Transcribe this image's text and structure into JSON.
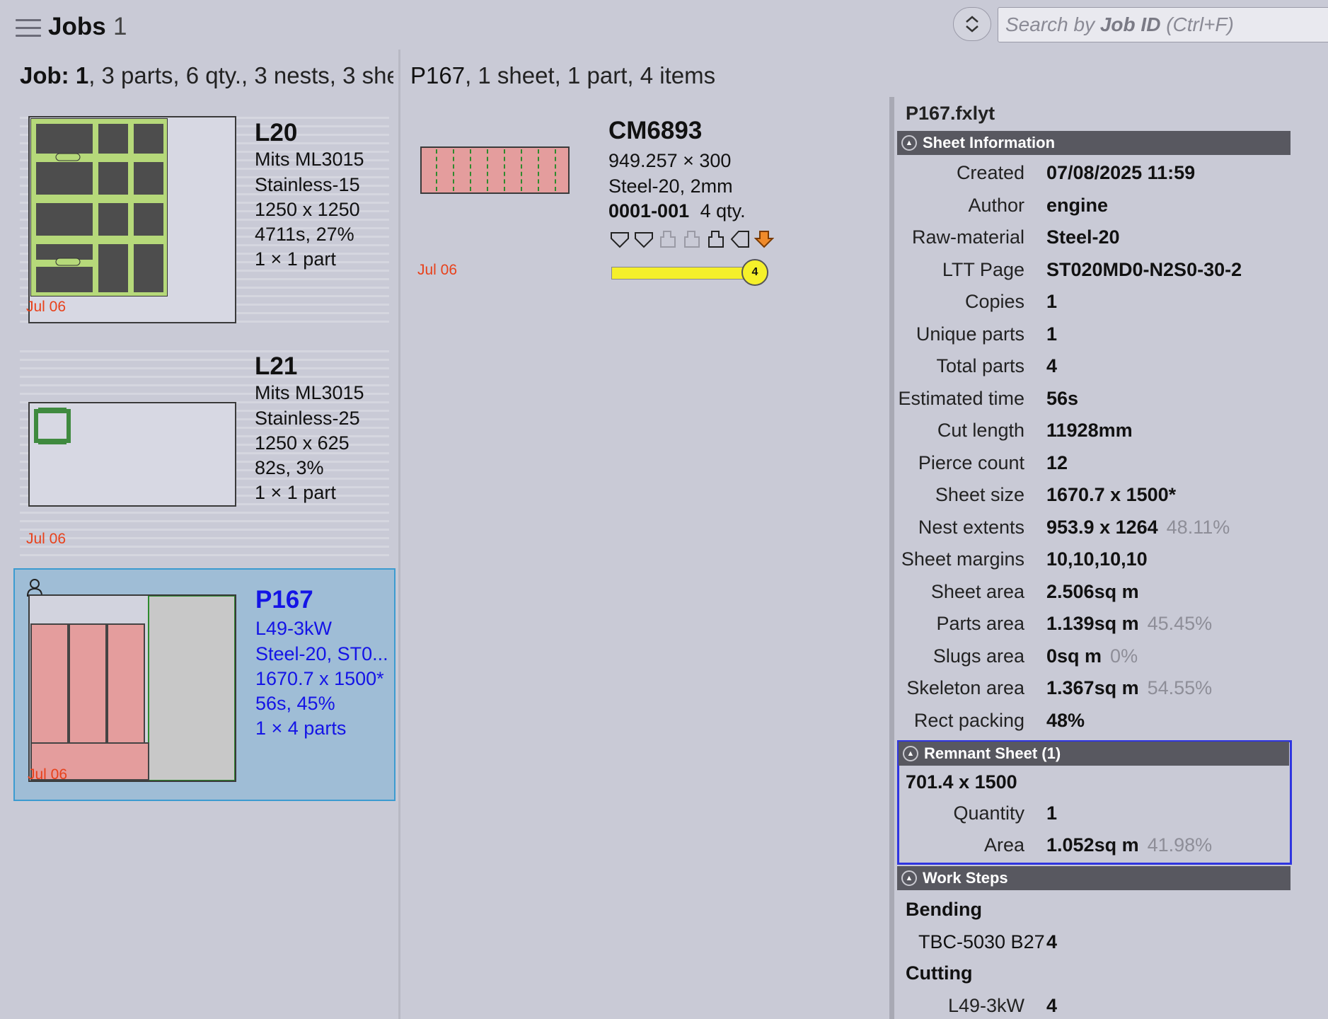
{
  "header": {
    "menu_icon": "hamburger-menu-icon",
    "title": "Jobs",
    "count": "1",
    "sort_icon": "sort-updown-icon",
    "search_placeholder_prefix": "Search by ",
    "search_placeholder_key": "Job ID",
    "search_placeholder_suffix": " (Ctrl+F)"
  },
  "job_summary": {
    "label": "Job: 1",
    "rest": ", 3 parts, 6 qty., 3 nests, 3 she"
  },
  "nest_summary": {
    "id": "P167",
    "rest": ", 1 sheet, 1 part, 4 items"
  },
  "nests": [
    {
      "name": "L20",
      "machine": "Mits ML3015",
      "material": "Stainless-15",
      "size": "1250 x 1250",
      "time": "4711s, 27%",
      "parts": "1 × 1 part",
      "date": "Jul 06"
    },
    {
      "name": "L21",
      "machine": "Mits ML3015",
      "material": "Stainless-25",
      "size": "1250 x 625",
      "time": "82s, 3%",
      "parts": "1 × 1 part",
      "date": "Jul 06"
    },
    {
      "name": "P167",
      "machine": "L49-3kW",
      "material": "Steel-20, ST0...",
      "size": "1670.7 x 1500*",
      "time": "56s, 45%",
      "parts": "1 × 4 parts",
      "date": "Jul 06",
      "user_icon": "user-icon"
    }
  ],
  "part": {
    "name": "CM6893",
    "dims": "949.257 × 300",
    "material": "Steel-20, 2mm",
    "order": "0001-001",
    "qty": "4 qty.",
    "date": "Jul 06",
    "progress_value": "4",
    "progress_fraction": 1.0,
    "step_icons": [
      "bend-down-icon",
      "bend-down-icon",
      "bend-faded-icon",
      "bend-faded-icon",
      "bend-up-icon",
      "bend-left-icon",
      "bend-active-icon"
    ]
  },
  "properties": {
    "file": "P167.fxlyt",
    "sheet_info_title": "Sheet Information",
    "rows": [
      {
        "label": "Created",
        "value": "07/08/2025 11:59",
        "pct": ""
      },
      {
        "label": "Author",
        "value": "engine",
        "pct": ""
      },
      {
        "label": "Raw-material",
        "value": "Steel-20",
        "pct": ""
      },
      {
        "label": "LTT Page",
        "value": "ST020MD0-N2S0-30-2",
        "pct": ""
      },
      {
        "label": "Copies",
        "value": "1",
        "pct": ""
      },
      {
        "label": "Unique parts",
        "value": "1",
        "pct": ""
      },
      {
        "label": "Total parts",
        "value": "4",
        "pct": ""
      },
      {
        "label": "Estimated time",
        "value": "56s",
        "pct": ""
      },
      {
        "label": "Cut length",
        "value": "11928mm",
        "pct": ""
      },
      {
        "label": "Pierce count",
        "value": "12",
        "pct": ""
      },
      {
        "label": "Sheet size",
        "value": "1670.7 x 1500*",
        "pct": ""
      },
      {
        "label": "Nest extents",
        "value": "953.9 x 1264",
        "pct": "48.11%"
      },
      {
        "label": "Sheet margins",
        "value": "10,10,10,10",
        "pct": ""
      },
      {
        "label": "Sheet area",
        "value": "2.506sq m",
        "pct": ""
      },
      {
        "label": "Parts area",
        "value": "1.139sq m",
        "pct": "45.45%"
      },
      {
        "label": "Slugs area",
        "value": "0sq m",
        "pct": "0%"
      },
      {
        "label": "Skeleton area",
        "value": "1.367sq m",
        "pct": "54.55%"
      },
      {
        "label": "Rect packing",
        "value": "48%",
        "pct": ""
      }
    ],
    "remnant_title": "Remnant Sheet (1)",
    "remnant_size": "701.4 x 1500",
    "remnant_rows": [
      {
        "label": "Quantity",
        "value": "1",
        "pct": ""
      },
      {
        "label": "Area",
        "value": "1.052sq m",
        "pct": "41.98%"
      }
    ],
    "work_steps_title": "Work Steps",
    "bending_title": "Bending",
    "bending_rows": [
      {
        "label": "TBC-5030 B27",
        "value": "4"
      }
    ],
    "cutting_title": "Cutting",
    "cutting_rows": [
      {
        "label": "L49-3kW",
        "value": "4"
      }
    ]
  },
  "colors": {
    "accent": "#1414e6",
    "date": "#e8411b",
    "selected_bg": "#9fbdd6",
    "part_fill": "#e49d9d",
    "sheet_green": "#b6d97a"
  }
}
